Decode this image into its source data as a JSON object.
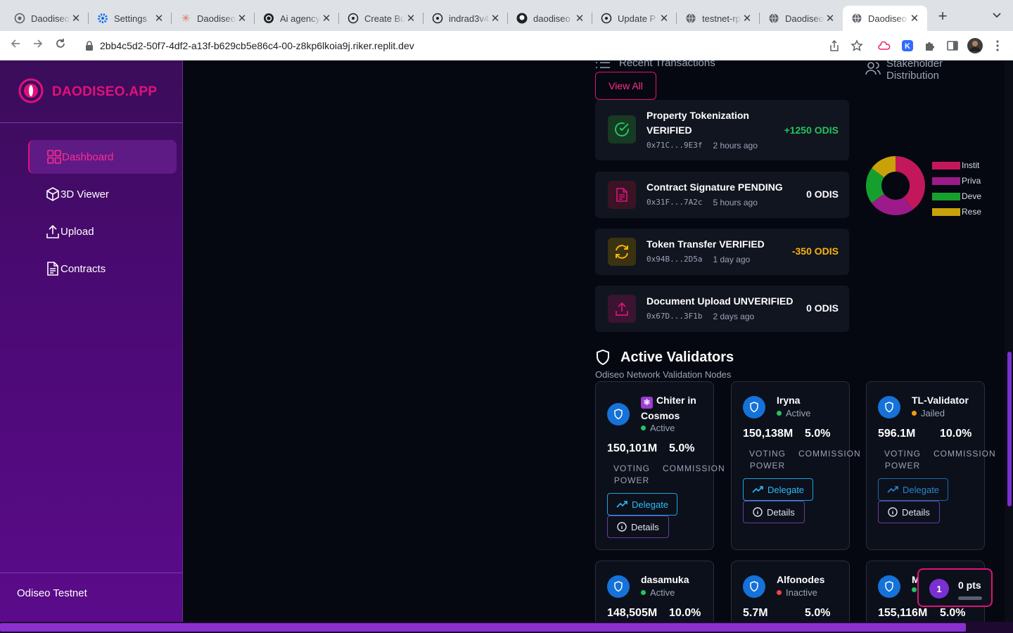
{
  "browser": {
    "tabs": [
      {
        "label": "Daodiseo",
        "favicon": "daodiseo-gray-icon"
      },
      {
        "label": "Settings",
        "favicon": "gear-icon"
      },
      {
        "label": "Daodiseo",
        "favicon": "claude-icon"
      },
      {
        "label": "Ai agency",
        "favicon": "openai-icon"
      },
      {
        "label": "Create Bu",
        "favicon": "replit-icon"
      },
      {
        "label": "indrad3v4",
        "favicon": "github-icon"
      },
      {
        "label": "daodiseo",
        "favicon": "github-icon"
      },
      {
        "label": "Update P",
        "favicon": "replit-icon"
      },
      {
        "label": "testnet-rp",
        "favicon": "globe-icon"
      },
      {
        "label": "Daodiseo",
        "favicon": "globe-icon"
      },
      {
        "label": "Daodiseo",
        "favicon": "globe-icon"
      }
    ],
    "active_tab_index": 10,
    "url": "2bb4c5d2-50f7-4df2-a13f-b629cb5e86c4-00-z8kp6lkoia9j.riker.replit.dev"
  },
  "sidebar": {
    "brand": "DAODISEO.APP",
    "items": [
      {
        "label": "Dashboard",
        "icon": "grid-icon",
        "active": true
      },
      {
        "label": "3D Viewer",
        "icon": "cube-icon",
        "active": false
      },
      {
        "label": "Upload",
        "icon": "upload-icon",
        "active": false
      },
      {
        "label": "Contracts",
        "icon": "document-icon",
        "active": false
      }
    ],
    "network": "Odiseo Testnet"
  },
  "recent_transactions": {
    "title": "Recent Transactions",
    "view_all": "View All",
    "items": [
      {
        "title": "Property Tokenization VERIFIED",
        "hash": "0x71C...9E3f",
        "time": "2 hours ago",
        "amount": "+1250 ODIS",
        "amount_color": "#22c55e",
        "icon": "check-circle-icon"
      },
      {
        "title": "Contract Signature PENDING",
        "hash": "0x31F...7A2c",
        "time": "5 hours ago",
        "amount": "0 ODIS",
        "amount_color": "#ffffff",
        "icon": "document-icon"
      },
      {
        "title": "Token Transfer VERIFIED",
        "hash": "0x94B...2D5a",
        "time": "1 day ago",
        "amount": "-350 ODIS",
        "amount_color": "#f5b50a",
        "icon": "refresh-icon"
      },
      {
        "title": "Document Upload UNVERIFIED",
        "hash": "0x67D...3F1b",
        "time": "2 days ago",
        "amount": "0 ODIS",
        "amount_color": "#ffffff",
        "icon": "upload-icon"
      }
    ]
  },
  "stakeholders": {
    "title_line1": "Stakeholder",
    "title_line2": "Distribution",
    "legend": [
      {
        "label": "Instit",
        "color": "#c2185b"
      },
      {
        "label": "Priva",
        "color": "#9c1a8a"
      },
      {
        "label": "Deve",
        "color": "#15a02e"
      },
      {
        "label": "Rese",
        "color": "#c9a20a"
      }
    ]
  },
  "validators": {
    "title": "Active Validators",
    "subtitle": "Odiseo Network Validation Nodes",
    "voting_label_1": "VOTING",
    "voting_label_2": "POWER",
    "commission_label": "COMMISSION",
    "delegate_label": "Delegate",
    "details_label": "Details",
    "items": [
      {
        "emoji": "⚛",
        "name_line1": "Chiter in",
        "name_line2": "Cosmos",
        "status": "Active",
        "status_color": "#22c55e",
        "power": "150,101M",
        "commission": "5.0%"
      },
      {
        "name_line1": "Iryna",
        "status": "Active",
        "status_color": "#22c55e",
        "power": "150,138M",
        "commission": "5.0%"
      },
      {
        "name_line1": "TL-Validator",
        "status": "Jailed",
        "status_color": "#f59e0b",
        "power": "596.1M",
        "commission": "10.0%"
      },
      {
        "name_line1": "dasamuka",
        "status": "Active",
        "status_color": "#22c55e",
        "power": "148,505M",
        "commission": "10.0%"
      },
      {
        "name_line1": "Alfonodes",
        "status": "Inactive",
        "status_color": "#ef4444",
        "power": "5.7M",
        "commission": "5.0%"
      },
      {
        "name_line1": "M",
        "status": "",
        "status_color": "#22c55e",
        "power": "155,116M",
        "commission": "5.0%"
      }
    ]
  },
  "points_widget": {
    "level": "1",
    "points": "0 pts"
  }
}
